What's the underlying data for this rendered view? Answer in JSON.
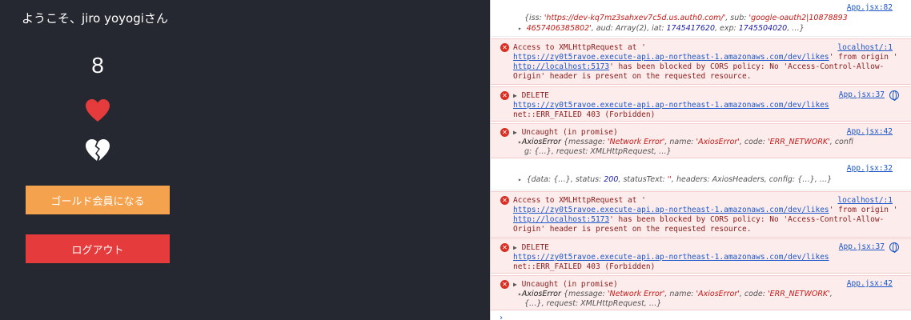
{
  "app": {
    "greeting": "ようこそ、jiro yoyogiさん",
    "like_count": "8",
    "gold_button": "ゴールド会員になる",
    "logout_button": "ログアウト",
    "colors": {
      "background": "#252830",
      "gold": "#f4a24d",
      "logout": "#e53b3d",
      "heart": "#e53b3d"
    },
    "icons": [
      "heart-icon",
      "broken-heart-icon"
    ]
  },
  "console": {
    "m0": {
      "src": "App.jsx:82",
      "l1a": "{iss: ",
      "l1b": "'https://dev-kq7mz3sahxev7c5d.us.auth0.com/'",
      "l1c": ", sub: ",
      "l1d": "'google-oauth2|10878893",
      "l2a": "4657406385802'",
      "l2b": ", aud: Array(2), iat: ",
      "l2c": "1745417620",
      "l2d": ", exp: ",
      "l2e": "1745504020",
      "l2f": ", …}"
    },
    "m1": {
      "src": "localhost/:1",
      "l1": "Access to XMLHttpRequest at '",
      "l2a": "https://zy0t5ravoe.execute-api.ap-northeast-1.amazonaws.com/dev/likes",
      "l2b": "' from origin '",
      "l3a": "http://localhost:5173",
      "l3b": "' has been blocked by CORS policy: No 'Access-Control-Allow-",
      "l4": "Origin' header is present on the requested resource."
    },
    "m2": {
      "src": "App.jsx:37",
      "l1": "DELETE",
      "l2": "https://zy0t5ravoe.execute-api.ap-northeast-1.amazonaws.com/dev/likes",
      "l3": "net::ERR_FAILED 403 (Forbidden)"
    },
    "m3": {
      "src": "App.jsx:42",
      "l1": "Uncaught (in promise)",
      "l2a": "AxiosError ",
      "l2b": "{message: ",
      "l2c": "'Network Error'",
      "l2d": ", name: ",
      "l2e": "'AxiosError'",
      "l2f": ", code: ",
      "l2g": "'ERR_NETWORK'",
      "l2h": ", confi",
      "l3": "g: {…}, request: XMLHttpRequest, …}"
    },
    "m4": {
      "src": "App.jsx:32",
      "l1a": "{data: {…}, status: ",
      "l1b": "200",
      "l1c": ", statusText: ",
      "l1d": "''",
      "l1e": ", headers: AxiosHeaders, config: {…}, …}"
    },
    "m5": {
      "src": "localhost/:1",
      "l1": "Access to XMLHttpRequest at '",
      "l2a": "https://zy0t5ravoe.execute-api.ap-northeast-1.amazonaws.com/dev/likes",
      "l2b": "' from origin '",
      "l3a": "http://localhost:5173",
      "l3b": "' has been blocked by CORS policy: No 'Access-Control-Allow-",
      "l4": "Origin' header is present on the requested resource."
    },
    "m6": {
      "src": "App.jsx:37",
      "l1": "DELETE",
      "l2": "https://zy0t5ravoe.execute-api.ap-northeast-1.amazonaws.com/dev/likes",
      "l3": "net::ERR_FAILED 403 (Forbidden)"
    },
    "m7": {
      "src": "App.jsx:42",
      "l1": "Uncaught (in promise)",
      "l2a": "AxiosError ",
      "l2b": "{message: ",
      "l2c": "'Network Error'",
      "l2d": ", name: ",
      "l2e": "'AxiosError'",
      "l2f": ", code: ",
      "l2g": "'ERR_NETWORK'",
      "l2h": ",",
      "l3": "{…}, request: XMLHttpRequest, …}"
    }
  }
}
